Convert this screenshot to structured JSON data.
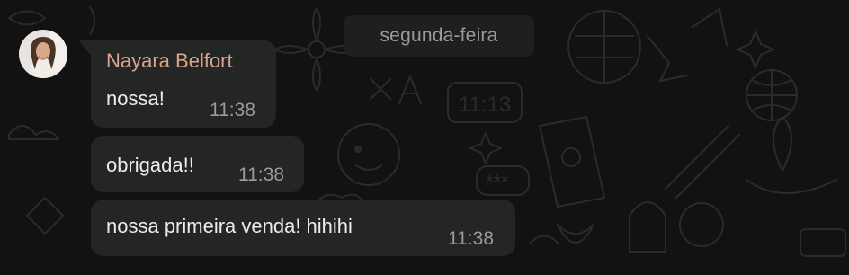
{
  "date_divider": "segunda-feira",
  "sender": {
    "name": "Nayara Belfort",
    "name_color": "#d8a48a"
  },
  "messages": [
    {
      "text": "nossa!",
      "time": "11:38"
    },
    {
      "text": "obrigada!!",
      "time": "11:38"
    },
    {
      "text": "nossa primeira venda! hihihi",
      "time": "11:38"
    }
  ],
  "colors": {
    "background": "#121212",
    "bubble": "#242626",
    "text": "#ececec",
    "meta": "#9a9c9c"
  },
  "icons": [
    "doodle-wallpaper",
    "avatar"
  ]
}
